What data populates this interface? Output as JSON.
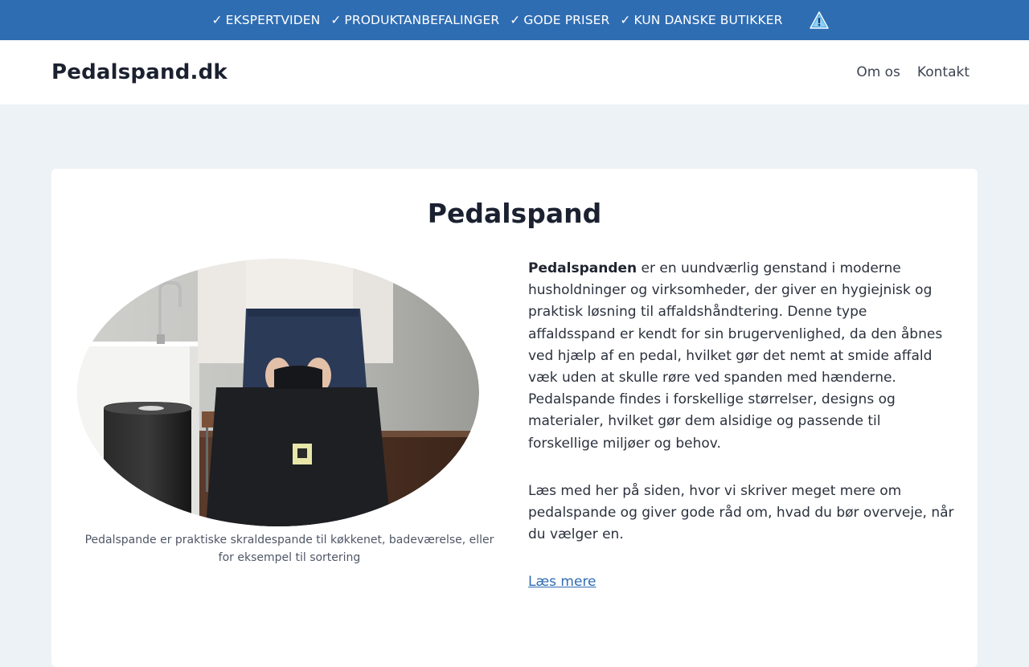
{
  "topbar": {
    "items": [
      {
        "check": "✓",
        "label": "EKSPERTVIDEN"
      },
      {
        "check": "✓",
        "label": "PRODUKTANBEFALINGER"
      },
      {
        "check": "✓",
        "label": "GODE PRISER"
      },
      {
        "check": "✓",
        "label": "KUN DANSKE BUTIKKER"
      }
    ],
    "icon": "warning-icon",
    "background": "#2f6db3"
  },
  "header": {
    "brand": "Pedalspand.dk",
    "nav": [
      {
        "label": "Om os"
      },
      {
        "label": "Kontakt"
      }
    ]
  },
  "main": {
    "title": "Pedalspand",
    "image_caption": "Pedalspande er praktiske skraldespande til køkkenet, badeværelse, eller for eksempel til sortering",
    "intro_bold": "Pedalspanden",
    "intro_rest": " er en uundværlig genstand i moderne husholdninger og virksomheder, der giver en hygiejnisk og praktisk løsning til affaldshåndtering. Denne type affaldsspand er kendt for sin brugervenlighed, da den åbnes ved hjælp af en pedal, hvilket gør det nemt at smide affald væk uden at skulle røre ved spanden med hænderne. Pedalspande findes i forskellige størrelser, designs og materialer, hvilket gør dem alsidige og passende til forskellige miljøer og behov.",
    "paragraph2": "Læs med her på siden, hvor vi skriver meget mere om pedalspande og giver gode råd om, hvad du bør overveje, når du vælger en.",
    "read_more": "Læs mere"
  },
  "colors": {
    "accent": "#2f6db3",
    "page_bg": "#edf2f6",
    "card_bg": "#ffffff"
  }
}
